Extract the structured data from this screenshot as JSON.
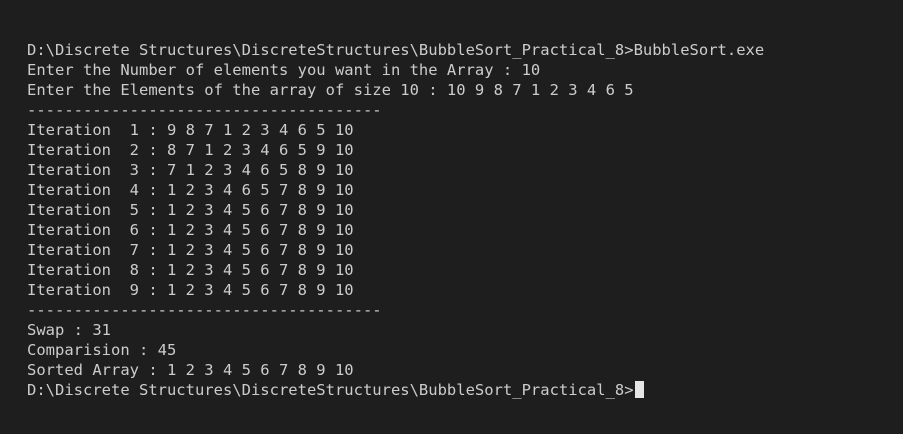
{
  "terminal": {
    "lines": [
      "D:\\Discrete Structures\\DiscreteStructures\\BubbleSort_Practical_8>BubbleSort.exe",
      "Enter the Number of elements you want in the Array : 10",
      "Enter the Elements of the array of size 10 : 10 9 8 7 1 2 3 4 6 5",
      "--------------------------------------",
      "Iteration  1 : 9 8 7 1 2 3 4 6 5 10",
      "Iteration  2 : 8 7 1 2 3 4 6 5 9 10",
      "Iteration  3 : 7 1 2 3 4 6 5 8 9 10",
      "Iteration  4 : 1 2 3 4 6 5 7 8 9 10",
      "Iteration  5 : 1 2 3 4 5 6 7 8 9 10",
      "Iteration  6 : 1 2 3 4 5 6 7 8 9 10",
      "Iteration  7 : 1 2 3 4 5 6 7 8 9 10",
      "Iteration  8 : 1 2 3 4 5 6 7 8 9 10",
      "Iteration  9 : 1 2 3 4 5 6 7 8 9 10",
      "--------------------------------------",
      "Swap : 31",
      "Comparision : 45",
      "Sorted Array : 1 2 3 4 5 6 7 8 9 10"
    ],
    "prompt": "D:\\Discrete Structures\\DiscreteStructures\\BubbleSort_Practical_8>"
  }
}
